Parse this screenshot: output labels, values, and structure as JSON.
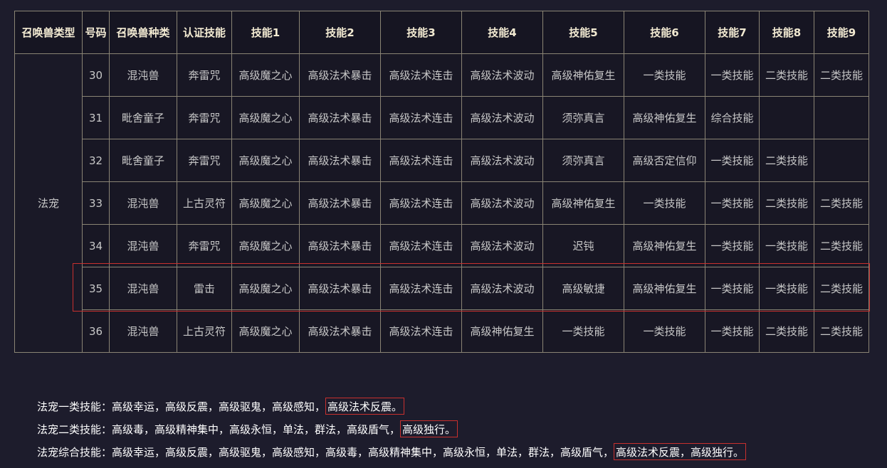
{
  "table": {
    "headers": [
      "召唤兽类型",
      "号码",
      "召唤兽种类",
      "认证技能",
      "技能1",
      "技能2",
      "技能3",
      "技能4",
      "技能5",
      "技能6",
      "技能7",
      "技能8",
      "技能9"
    ],
    "type_label": "法宠",
    "rows": [
      {
        "num": "30",
        "kind": "混沌兽",
        "cert": "奔雷咒",
        "s1": "高级魔之心",
        "s2": "高级法术暴击",
        "s3": "高级法术连击",
        "s4": "高级法术波动",
        "s5": "高级神佑复生",
        "s6": "一类技能",
        "s7": "一类技能",
        "s8": "二类技能",
        "s9": "二类技能"
      },
      {
        "num": "31",
        "kind": "毗舍童子",
        "cert": "奔雷咒",
        "s1": "高级魔之心",
        "s2": "高级法术暴击",
        "s3": "高级法术连击",
        "s4": "高级法术波动",
        "s5": "须弥真言",
        "s6": "高级神佑复生",
        "s7": "综合技能",
        "s8": "",
        "s9": ""
      },
      {
        "num": "32",
        "kind": "毗舍童子",
        "cert": "奔雷咒",
        "s1": "高级魔之心",
        "s2": "高级法术暴击",
        "s3": "高级法术连击",
        "s4": "高级法术波动",
        "s5": "须弥真言",
        "s6": "高级否定信仰",
        "s7": "一类技能",
        "s8": "二类技能",
        "s9": ""
      },
      {
        "num": "33",
        "kind": "混沌兽",
        "cert": "上古灵符",
        "s1": "高级魔之心",
        "s2": "高级法术暴击",
        "s3": "高级法术连击",
        "s4": "高级法术波动",
        "s5": "高级神佑复生",
        "s6": "一类技能",
        "s7": "一类技能",
        "s8": "二类技能",
        "s9": "二类技能"
      },
      {
        "num": "34",
        "kind": "混沌兽",
        "cert": "奔雷咒",
        "s1": "高级魔之心",
        "s2": "高级法术暴击",
        "s3": "高级法术连击",
        "s4": "高级法术波动",
        "s5": "迟钝",
        "s6": "高级神佑复生",
        "s7": "一类技能",
        "s8": "一类技能",
        "s9": "二类技能"
      },
      {
        "num": "35",
        "kind": "混沌兽",
        "cert": "雷击",
        "s1": "高级魔之心",
        "s2": "高级法术暴击",
        "s3": "高级法术连击",
        "s4": "高级法术波动",
        "s5": "高级敏捷",
        "s6": "高级神佑复生",
        "s7": "一类技能",
        "s8": "一类技能",
        "s9": "二类技能"
      },
      {
        "num": "36",
        "kind": "混沌兽",
        "cert": "上古灵符",
        "s1": "高级魔之心",
        "s2": "高级法术暴击",
        "s3": "高级法术连击",
        "s4": "高级神佑复生",
        "s5": "一类技能",
        "s6": "一类技能",
        "s7": "一类技能",
        "s8": "二类技能",
        "s9": "二类技能"
      }
    ]
  },
  "notes": [
    {
      "text": "法宠一类技能：高级幸运，高级反震，高级驱鬼，高级感知，",
      "highlight": "高级法术反震。"
    },
    {
      "text": "法宠二类技能：高级毒，高级精神集中，高级永恒，单法，群法，高级盾气，",
      "highlight": "高级独行。"
    },
    {
      "text": "法宠综合技能：高级幸运，高级反震，高级驱鬼，高级感知，高级毒，高级精神集中，高级永恒，单法，群法，高级盾气，",
      "highlight": "高级法术反震，高级独行。"
    }
  ],
  "colors": {
    "background": "#1d1c2c",
    "border": "#8a8474",
    "header_text": "#f2ead2",
    "highlight_border": "#c8302e"
  }
}
